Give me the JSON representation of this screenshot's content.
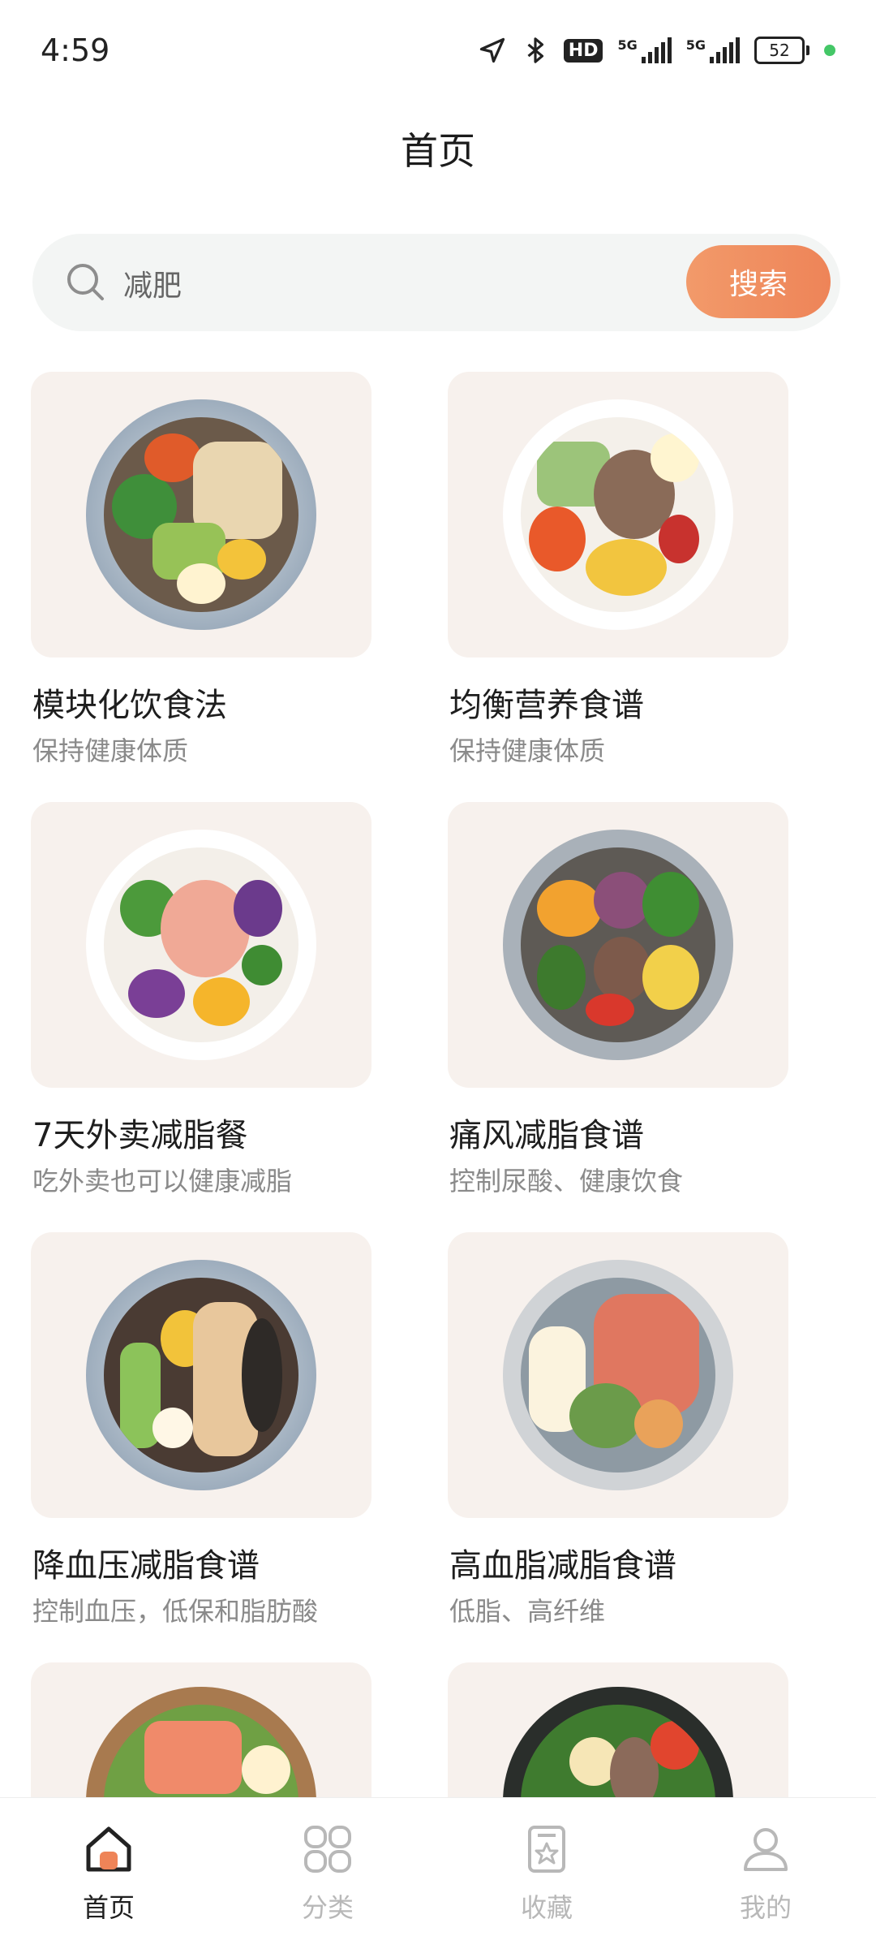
{
  "status_bar": {
    "time": "4:59",
    "hd_badge": "HD",
    "signal_1": "5G",
    "signal_2": "5G",
    "battery": "52"
  },
  "header": {
    "title": "首页"
  },
  "search": {
    "value": "减肥",
    "button_label": "搜索"
  },
  "recipes": [
    {
      "title": "模块化饮食法",
      "subtitle": "保持健康体质"
    },
    {
      "title": "均衡营养食谱",
      "subtitle": "保持健康体质"
    },
    {
      "title": "7天外卖减脂餐",
      "subtitle": "吃外卖也可以健康减脂"
    },
    {
      "title": "痛风减脂食谱",
      "subtitle": "控制尿酸、健康饮食"
    },
    {
      "title": "降血压减脂食谱",
      "subtitle": "控制血压，低保和脂肪酸"
    },
    {
      "title": "高血脂减脂食谱",
      "subtitle": "低脂、高纤维"
    }
  ],
  "bottom_nav": [
    {
      "label": "首页",
      "icon": "home-icon",
      "active": true
    },
    {
      "label": "分类",
      "icon": "category-icon",
      "active": false
    },
    {
      "label": "收藏",
      "icon": "favorites-icon",
      "active": false
    },
    {
      "label": "我的",
      "icon": "profile-icon",
      "active": false
    }
  ],
  "colors": {
    "accent": "#ee8458",
    "card_bg": "#f7f1ed",
    "search_bg": "#f3f5f4"
  }
}
